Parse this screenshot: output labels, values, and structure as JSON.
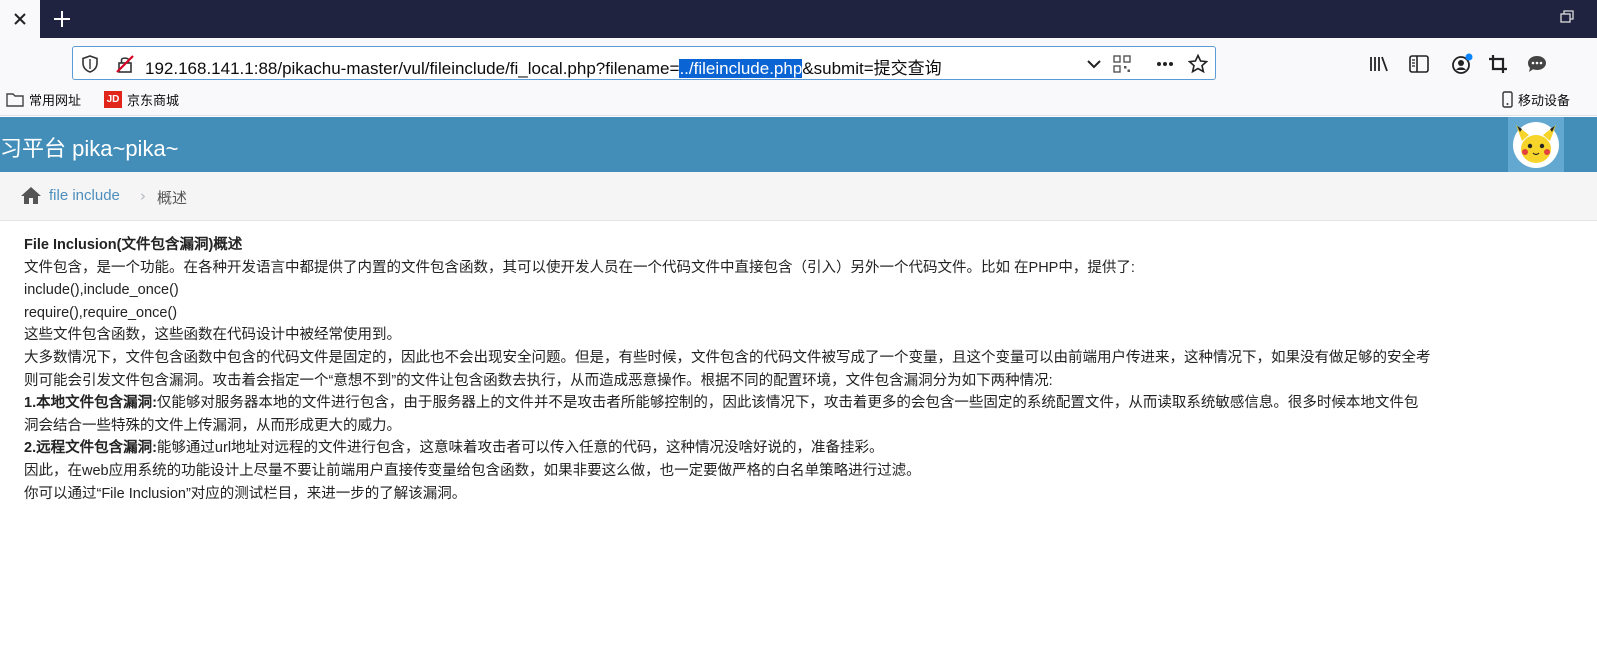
{
  "browser": {
    "url_prefix": "192.168.141.1:88/pikachu-master/vul/fileinclude/fi_local.php?filename=",
    "url_selected": "../fileinclude.php",
    "url_suffix": "&submit=提交查询",
    "bookmarks": [
      "常用网址",
      "京东商城"
    ],
    "bookmark_right": "移动设备",
    "jd_badge": "JD"
  },
  "site": {
    "title": "习平台 pika~pika~"
  },
  "breadcrumb": {
    "link": "file include",
    "separator": "›",
    "current": "概述"
  },
  "content": {
    "heading": "File Inclusion(文件包含漏洞)概述",
    "p1": "文件包含，是一个功能。在各种开发语言中都提供了内置的文件包含函数，其可以使开发人员在一个代码文件中直接包含（引入）另外一个代码文件。比如 在PHP中，提供了:",
    "p2": "include(),include_once()",
    "p3": "require(),require_once()",
    "p4": "这些文件包含函数，这些函数在代码设计中被经常使用到。",
    "p5": "大多数情况下，文件包含函数中包含的代码文件是固定的，因此也不会出现安全问题。但是，有些时候，文件包含的代码文件被写成了一个变量，且这个变量可以由前端用户传进来，这种情况下，如果没有做足够的安全考",
    "p6": "则可能会引发文件包含漏洞。攻击着会指定一个“意想不到”的文件让包含函数去执行，从而造成恶意操作。根据不同的配置环境，文件包含漏洞分为如下两种情况:",
    "local_label": "1.本地文件包含漏洞:",
    "local_text": "仅能够对服务器本地的文件进行包含，由于服务器上的文件并不是攻击者所能够控制的，因此该情况下，攻击着更多的会包含一些固定的系统配置文件，从而读取系统敏感信息。很多时候本地文件包",
    "p8": "洞会结合一些特殊的文件上传漏洞，从而形成更大的威力。",
    "remote_label": "2.远程文件包含漏洞:",
    "remote_text": "能够通过url地址对远程的文件进行包含，这意味着攻击者可以传入任意的代码，这种情况没啥好说的，准备挂彩。",
    "p10": "因此，在web应用系统的功能设计上尽量不要让前端用户直接传变量给包含函数，如果非要这么做，也一定要做严格的白名单策略进行过滤。",
    "p11": "你可以通过“File Inclusion”对应的测试栏目，来进一步的了解该漏洞。"
  }
}
